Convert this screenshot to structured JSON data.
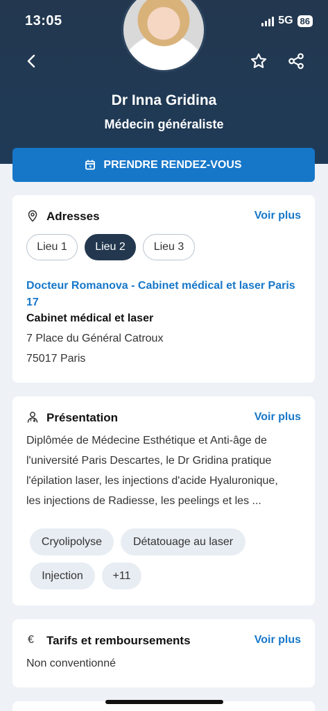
{
  "status_bar": {
    "time": "13:05",
    "network": "5G",
    "battery": "86"
  },
  "doctor": {
    "name": "Dr Inna Gridina",
    "specialty": "Médecin généraliste"
  },
  "cta": {
    "label": "PRENDRE RENDEZ-VOUS"
  },
  "addresses": {
    "title": "Adresses",
    "more": "Voir plus",
    "tabs": [
      {
        "label": "Lieu 1",
        "active": false
      },
      {
        "label": "Lieu 2",
        "active": true
      },
      {
        "label": "Lieu 3",
        "active": false
      }
    ],
    "place_name_line1": "Docteur Romanova - Cabinet médical et laser Paris",
    "place_name_line2": "17",
    "place_type": "Cabinet médical et laser",
    "street": "7 Place du Général Catroux",
    "city": "75017 Paris"
  },
  "presentation": {
    "title": "Présentation",
    "more": "Voir plus",
    "lines": [
      "Diplômée de Médecine Esthétique et Anti-âge de",
      "l'université Paris Descartes, le Dr Gridina pratique",
      "l'épilation laser, les injections d'acide Hyaluronique,",
      "les injections de Radiesse, les peelings et les ..."
    ],
    "tags": [
      "Cryolipolyse",
      "Détatouage au laser",
      "Injection",
      "+11"
    ]
  },
  "fees": {
    "title": "Tarifs et remboursements",
    "more": "Voir plus",
    "value": "Non conventionné"
  },
  "colors": {
    "header": "#23384f",
    "accent": "#1677c9",
    "background": "#eef2f7"
  },
  "icons": [
    "back-arrow-icon",
    "star-icon",
    "share-icon",
    "calendar-icon",
    "location-pin-icon",
    "doctor-icon",
    "euro-icon"
  ]
}
